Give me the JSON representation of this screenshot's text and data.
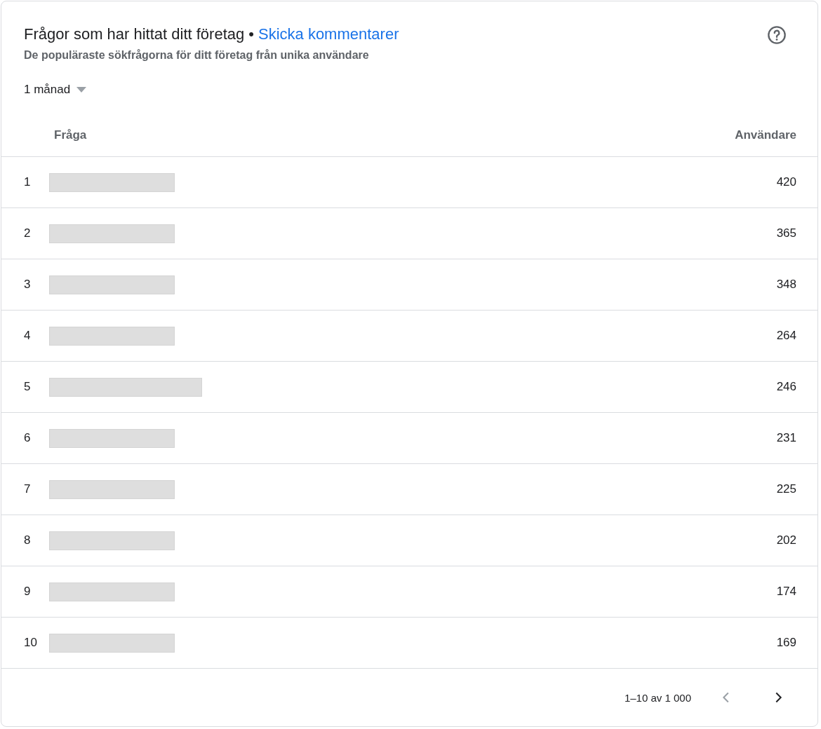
{
  "header": {
    "title": "Frågor som har hittat ditt företag",
    "separator": "•",
    "link": "Skicka kommentarer",
    "subtitle": "De populäraste sökfrågorna för ditt företag från unika användare"
  },
  "period": {
    "label": "1 månad"
  },
  "table": {
    "columns": [
      "Fråga",
      "Användare"
    ],
    "rows": [
      {
        "rank": "1",
        "query": {
          "kind": "redacted",
          "wide": false
        },
        "users": "420"
      },
      {
        "rank": "2",
        "query": {
          "kind": "redacted",
          "wide": false
        },
        "users": "365"
      },
      {
        "rank": "3",
        "query": {
          "kind": "redacted",
          "wide": false
        },
        "users": "348"
      },
      {
        "rank": "4",
        "query": {
          "kind": "redacted",
          "wide": false
        },
        "users": "264"
      },
      {
        "rank": "5",
        "query": {
          "kind": "redacted",
          "wide": true
        },
        "users": "246"
      },
      {
        "rank": "6",
        "query": {
          "kind": "redacted",
          "wide": false
        },
        "users": "231"
      },
      {
        "rank": "7",
        "query": {
          "kind": "redacted",
          "wide": false
        },
        "users": "225"
      },
      {
        "rank": "8",
        "query": {
          "kind": "redacted",
          "wide": false
        },
        "users": "202"
      },
      {
        "rank": "9",
        "query": {
          "kind": "redacted",
          "wide": false
        },
        "users": "174"
      },
      {
        "rank": "10",
        "query": {
          "kind": "redacted",
          "wide": false
        },
        "users": "169"
      }
    ]
  },
  "pagination": {
    "range": "1–10 av 1 000",
    "previous": {
      "disabled": true
    },
    "next": {
      "disabled": false
    }
  }
}
